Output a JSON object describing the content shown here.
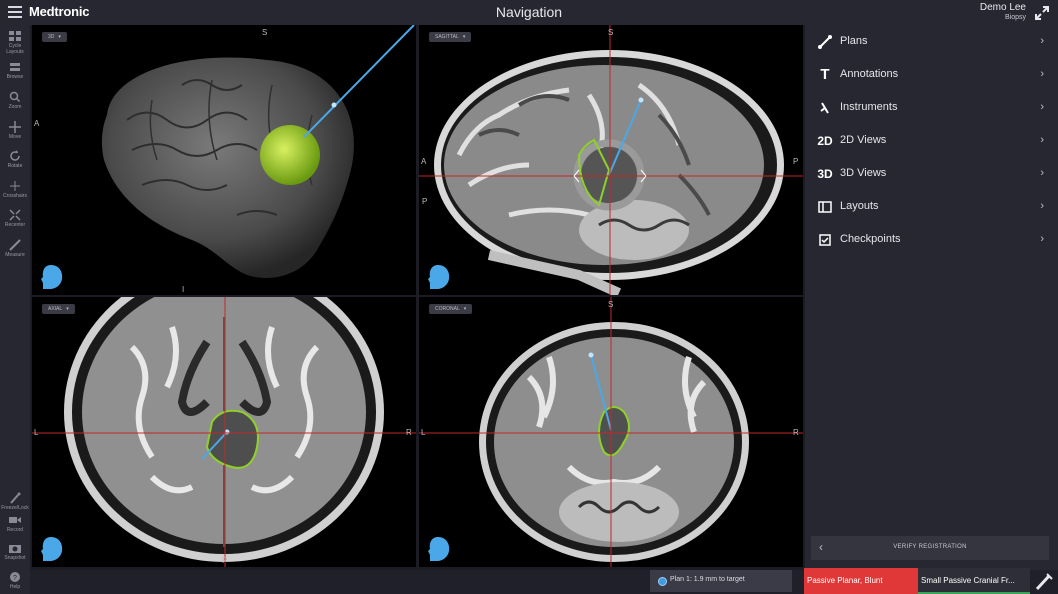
{
  "header": {
    "brand": "Medtronic",
    "title": "Navigation",
    "user_name": "Demo Lee",
    "user_sub": "Biopsy",
    "icons": [
      "menu-icon",
      "expand-icon"
    ]
  },
  "toolbar": {
    "top_items": [
      {
        "label": "Cycle Layouts",
        "icon": "cycle-layouts-icon"
      },
      {
        "label": "Browse",
        "icon": "browse-icon"
      },
      {
        "label": "Zoom",
        "icon": "zoom-icon"
      },
      {
        "label": "Move",
        "icon": "move-icon"
      },
      {
        "label": "Rotate",
        "icon": "rotate-icon"
      },
      {
        "label": "Crosshairs",
        "icon": "crosshairs-icon"
      },
      {
        "label": "Recenter",
        "icon": "recenter-icon"
      },
      {
        "label": "Measure",
        "icon": "measure-icon"
      }
    ],
    "bottom_items": [
      {
        "label": "Freeze/Lock",
        "icon": "probe-icon"
      },
      {
        "label": "Record",
        "icon": "record-icon"
      },
      {
        "label": "Snapshot",
        "icon": "snapshot-icon"
      },
      {
        "label": "Help",
        "icon": "help-icon"
      }
    ]
  },
  "viewports": {
    "v3d": {
      "label": "3D",
      "orient": {
        "top": "S",
        "left": "A",
        "bottom": "I"
      }
    },
    "sagittal": {
      "label": "SAGITTAL",
      "orient": {
        "top": "S",
        "left": "A",
        "right": "P",
        "left2": "P"
      }
    },
    "axial": {
      "label": "AXIAL",
      "orient": {
        "left": "L",
        "right": "R",
        "bottom": "P"
      }
    },
    "coronal": {
      "label": "CORONAL",
      "orient": {
        "top": "S",
        "left": "L",
        "right": "R"
      }
    }
  },
  "right_panel": {
    "items": [
      {
        "label": "Plans",
        "icon": "plans-icon",
        "glyph": ""
      },
      {
        "label": "Annotations",
        "icon": "annotations-icon",
        "glyph": "T"
      },
      {
        "label": "Instruments",
        "icon": "instruments-icon",
        "glyph": ""
      },
      {
        "label": "2D Views",
        "icon": "2d-views-icon",
        "glyph": "2D"
      },
      {
        "label": "3D Views",
        "icon": "3d-views-icon",
        "glyph": "3D"
      },
      {
        "label": "Layouts",
        "icon": "layouts-icon",
        "glyph": ""
      },
      {
        "label": "Checkpoints",
        "icon": "checkpoints-icon",
        "glyph": ""
      }
    ],
    "verify_label": "VERIFY REGISTRATION"
  },
  "status": {
    "plan_text": "Plan 1: 1.9 mm to target",
    "tool1": "Passive Planar, Blunt",
    "tool2": "Small Passive Cranial Fr...",
    "colors": {
      "tool1_bg": "#e03838",
      "tool2_underline": "#3aa55a",
      "accent": "#3f9be0"
    }
  }
}
